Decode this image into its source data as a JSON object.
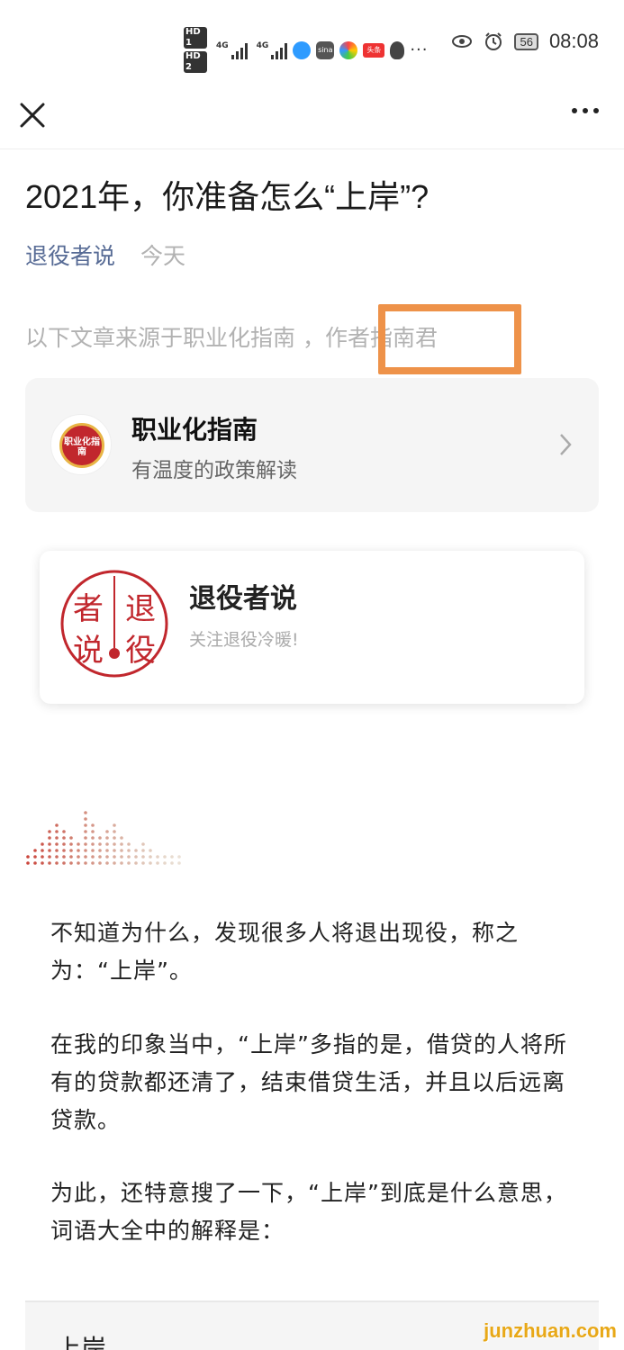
{
  "status_bar": {
    "hd1": "HD 1",
    "hd2": "HD 2",
    "sig1_label": "4G",
    "sig2_label": "4G",
    "app_label_sina": "sina",
    "app_label_toutiao": "头条",
    "dots": "···",
    "battery": "56",
    "time": "08:08"
  },
  "nav": {
    "close_icon": "close-icon",
    "more_icon": "more-icon"
  },
  "article": {
    "title": "2021年，你准备怎么“上岸”?",
    "author": "退役者说",
    "date": "今天",
    "intro": "以下文章来源于职业化指南 ，作者指南君"
  },
  "account_card": {
    "logo_text": "职业化指南",
    "name": "职业化指南",
    "description": "有温度的政策解读"
  },
  "profile_card": {
    "seal_text": [
      "退",
      "役",
      "者",
      "说"
    ],
    "name": "退役者说",
    "description": "关注退役冷暖!"
  },
  "body": {
    "p1": "不知道为什么，发现很多人将退出现役，称之为：“上岸”。",
    "p2": "在我的印象当中，“上岸”多指的是，借贷的人将所有的贷款都还清了，结束借贷生活，并且以后远离贷款。",
    "p3": "为此，还特意搜了一下，“上岸”到底是什么意思，词语大全中的解释是：",
    "quote_heading": "上岸"
  },
  "watermark": "junzhuan.com",
  "colors": {
    "link": "#576b95",
    "highlight": "#ee9249",
    "seal_red": "#c1272d"
  }
}
